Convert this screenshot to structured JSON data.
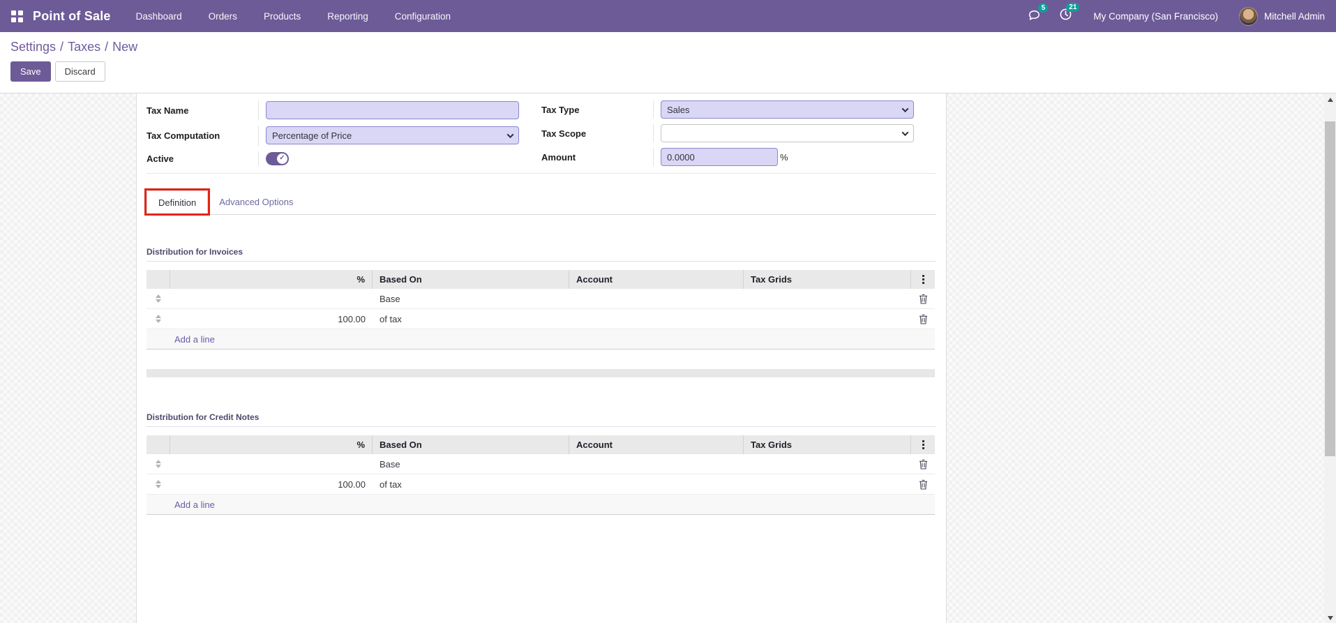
{
  "navbar": {
    "app_name": "Point of Sale",
    "menu_items": [
      "Dashboard",
      "Orders",
      "Products",
      "Reporting",
      "Configuration"
    ],
    "messages_badge": "5",
    "activities_badge": "21",
    "company": "My Company (San Francisco)",
    "user": "Mitchell Admin"
  },
  "breadcrumb": {
    "separator": "/",
    "items": [
      "Settings",
      "Taxes",
      "New"
    ]
  },
  "buttons": {
    "save": "Save",
    "discard": "Discard"
  },
  "form": {
    "tax_name": {
      "label": "Tax Name",
      "value": ""
    },
    "tax_computation": {
      "label": "Tax Computation",
      "value": "Percentage of Price"
    },
    "active": {
      "label": "Active",
      "state": "on"
    },
    "tax_type": {
      "label": "Tax Type",
      "value": "Sales"
    },
    "tax_scope": {
      "label": "Tax Scope",
      "value": ""
    },
    "amount": {
      "label": "Amount",
      "value": "0.0000",
      "unit": "%"
    }
  },
  "tabs": {
    "definition": "Definition",
    "advanced_options": "Advanced Options"
  },
  "invoices": {
    "title": "Distribution for Invoices",
    "columns": {
      "percent": "%",
      "based_on": "Based On",
      "account": "Account",
      "tax_grids": "Tax Grids"
    },
    "rows": [
      {
        "percent": "",
        "based_on": "Base",
        "account": "",
        "tax_grids": ""
      },
      {
        "percent": "100.00",
        "based_on": "of tax",
        "account": "",
        "tax_grids": ""
      }
    ],
    "add_line": "Add a line"
  },
  "credit_notes": {
    "title": "Distribution for Credit Notes",
    "columns": {
      "percent": "%",
      "based_on": "Based On",
      "account": "Account",
      "tax_grids": "Tax Grids"
    },
    "rows": [
      {
        "percent": "",
        "based_on": "Base",
        "account": "",
        "tax_grids": ""
      },
      {
        "percent": "100.00",
        "based_on": "of tax",
        "account": "",
        "tax_grids": ""
      }
    ],
    "add_line": "Add a line"
  },
  "colors": {
    "navbar": "#6d5b98",
    "accent": "#6d5b98",
    "badge": "#0f9e9a",
    "annotation_red": "#e42313",
    "field_fill": "#d9d7f5"
  }
}
